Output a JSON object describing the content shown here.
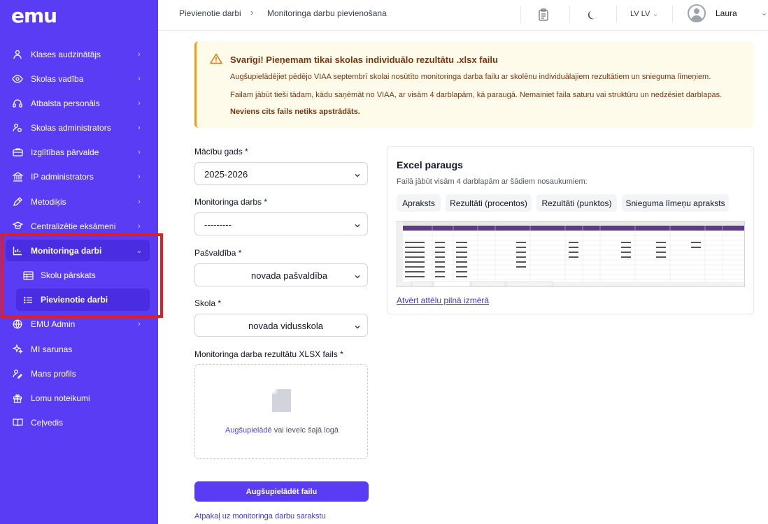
{
  "app": {
    "logo": "emu"
  },
  "sidebar": {
    "items": [
      {
        "label": "Klases audzinātājs",
        "icon": "teacher-icon"
      },
      {
        "label": "Skolas vadība",
        "icon": "eye-icon"
      },
      {
        "label": "Atbalsta personāls",
        "icon": "support-icon"
      },
      {
        "label": "Skolas administrators",
        "icon": "admin-icon"
      },
      {
        "label": "Izglītības pārvalde",
        "icon": "briefcase-icon"
      },
      {
        "label": "IP administrators",
        "icon": "bank-icon"
      },
      {
        "label": "Metodiķis",
        "icon": "pen-icon"
      },
      {
        "label": "Centralizētie eksāmeni",
        "icon": "exam-icon"
      },
      {
        "label": "Monitoringa darbi",
        "icon": "chart-icon"
      },
      {
        "label": "EMU Admin",
        "icon": "globe-icon"
      },
      {
        "label": "MI sarunas",
        "icon": "sparkles-icon"
      },
      {
        "label": "Mans profils",
        "icon": "profile-icon"
      },
      {
        "label": "Lomu noteikumi",
        "icon": "gift-icon"
      },
      {
        "label": "Ceļvedis",
        "icon": "book-icon"
      }
    ],
    "sub_items": [
      {
        "label": "Skolu pārskats",
        "icon": "table-icon"
      },
      {
        "label": "Pievienotie darbi",
        "icon": "list-icon"
      }
    ]
  },
  "header": {
    "breadcrumb_parent": "Pievienotie darbi",
    "breadcrumb_current": "Monitoringa darbu pievienošana",
    "language": "LV LV",
    "user_name": "Laura"
  },
  "alert": {
    "title": "Svarīgi! Pieņemam tikai skolas individuālo rezultātu .xlsx failu",
    "line1": "Augšupielādējiet pēdējo VIAA septembrī skolai nosūtīto monitoringa darba failu ar skolēnu individuālajiem rezultātiem un snieguma līmeņiem.",
    "line2": "Failam jābūt tieši tādam, kādu saņēmāt no VIAA, ar visām 4 darblapām, kā paraugā. Nemainiet faila saturu vai struktūru un nedzēsiet darblapas.",
    "line3": "Neviens cits fails netiks apstrādāts."
  },
  "form": {
    "year_label": "Mācību gads *",
    "year_value": "2025-2026",
    "work_label": "Monitoringa darbs *",
    "work_value": "---------",
    "municipality_label": "Pašvaldība *",
    "municipality_value": "novada pašvaldība",
    "school_label": "Skola *",
    "school_value": "novada vidusskola",
    "file_label": "Monitoringa darba rezultātu XLSX fails *",
    "upload_link": "Augšupielādē",
    "upload_rest": "vai ievelc šajā logā",
    "submit_label": "Augšupielādēt failu",
    "back_label": "Atpakaļ uz monitoringa darbu sarakstu"
  },
  "excel_card": {
    "title": "Excel paraugs",
    "subtitle": "Failā jābūt visām 4 darblapām ar šādiem nosaukumiem:",
    "sheets": [
      "Apraksts",
      "Rezultāti (procentos)",
      "Rezultāti (punktos)",
      "Snieguma līmeņu apraksts"
    ],
    "open_full": "Atvērt attēlu pilnā izmērā"
  }
}
